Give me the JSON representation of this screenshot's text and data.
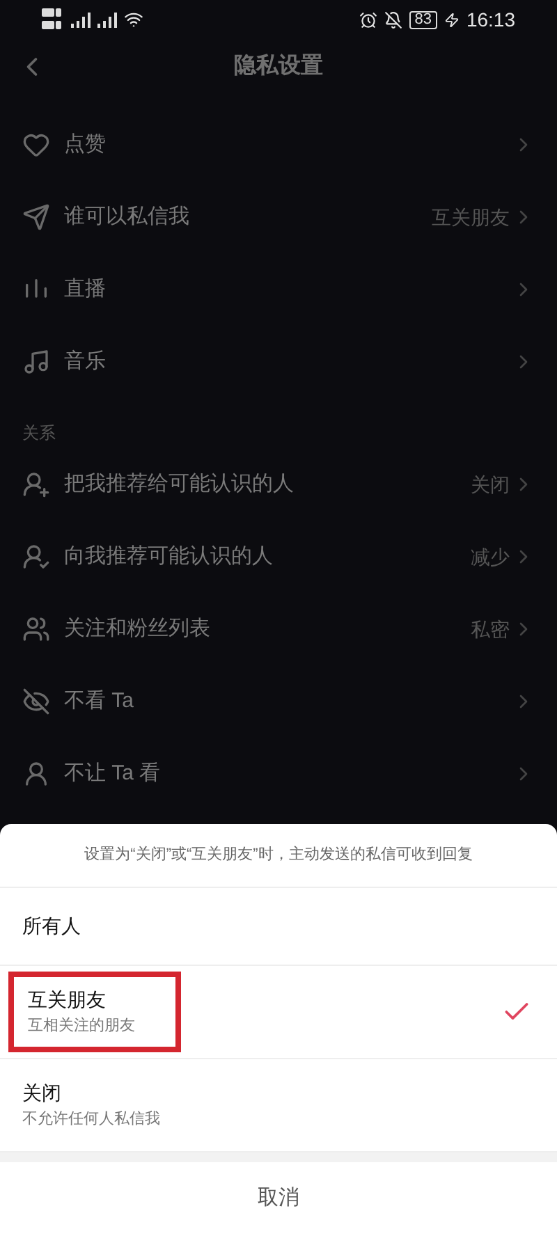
{
  "status_bar": {
    "battery": "83",
    "time": "16:13"
  },
  "header": {
    "title": "隐私设置"
  },
  "sections": [
    {
      "items": [
        {
          "label": "点赞"
        },
        {
          "label": "谁可以私信我",
          "value": "互关朋友"
        },
        {
          "label": "直播"
        },
        {
          "label": "音乐"
        }
      ]
    },
    {
      "title": "关系",
      "items": [
        {
          "label": "把我推荐给可能认识的人",
          "value": "关闭"
        },
        {
          "label": "向我推荐可能认识的人",
          "value": "减少"
        },
        {
          "label": "关注和粉丝列表",
          "value": "私密"
        },
        {
          "label": "不看 Ta"
        },
        {
          "label": "不让 Ta 看"
        }
      ]
    }
  ],
  "sheet": {
    "note": "设置为“关闭”或“互关朋友”时，主动发送的私信可收到回复",
    "options": [
      {
        "label": "所有人",
        "selected": false,
        "highlighted": false
      },
      {
        "label": "互关朋友",
        "description": "互相关注的朋友",
        "selected": true,
        "highlighted": true
      },
      {
        "label": "关闭",
        "description": "不允许任何人私信我",
        "selected": false,
        "highlighted": false
      }
    ],
    "cancel": "取消"
  }
}
